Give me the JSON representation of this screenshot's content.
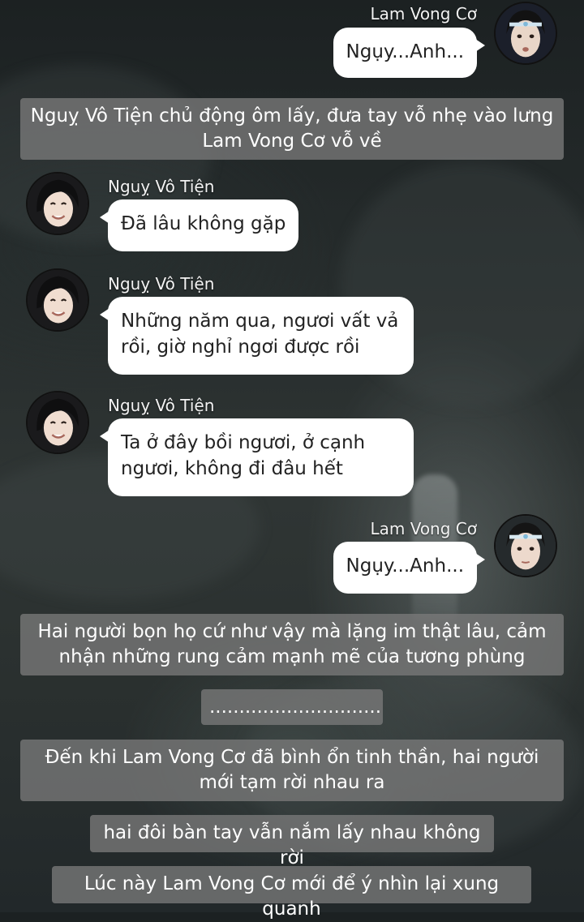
{
  "background": {
    "base_color": "#2a302f",
    "bubble_color": "#ffffff",
    "narration_color": "#7a7a7a"
  },
  "messages": [
    {
      "sender": "Lam Vong Cơ",
      "text": "Ngụy...Anh...",
      "side": "right",
      "avatar_icon": "lam-vong-co-avatar"
    },
    {
      "narration": "Nguỵ Vô Tiện chủ động ôm lấy, đưa tay vỗ nhẹ vào lưng Lam Vong Cơ vỗ về"
    },
    {
      "sender": "Nguỵ Vô Tiện",
      "text": "Đã lâu không gặp",
      "side": "left",
      "avatar_icon": "nguy-vo-tien-avatar"
    },
    {
      "sender": "Nguỵ Vô Tiện",
      "text": "Những năm qua, ngươi vất vả rồi, giờ nghỉ ngơi được rồi",
      "side": "left",
      "avatar_icon": "nguy-vo-tien-avatar"
    },
    {
      "sender": "Nguỵ Vô Tiện",
      "text": "Ta ở đây bồi ngươi, ở cạnh ngươi, không đi đâu hết",
      "side": "left",
      "avatar_icon": "nguy-vo-tien-avatar"
    },
    {
      "sender": "Lam Vong Cơ",
      "text": "Ngụy...Anh...",
      "side": "right",
      "avatar_icon": "lam-vong-co-avatar"
    },
    {
      "narration": "Hai người bọn họ cứ như vậy mà lặng im thật lâu, cảm nhận những rung cảm mạnh mẽ của tương phùng"
    },
    {
      "narration": "............................."
    },
    {
      "narration": "Đến khi Lam Vong Cơ đã bình ổn tinh thần, hai người mới tạm rời nhau ra"
    },
    {
      "narration": "hai đôi bàn tay vẫn nắm lấy nhau không rời"
    },
    {
      "narration": "Lúc này Lam Vong Cơ mới để ý nhìn lại xung quanh"
    }
  ]
}
